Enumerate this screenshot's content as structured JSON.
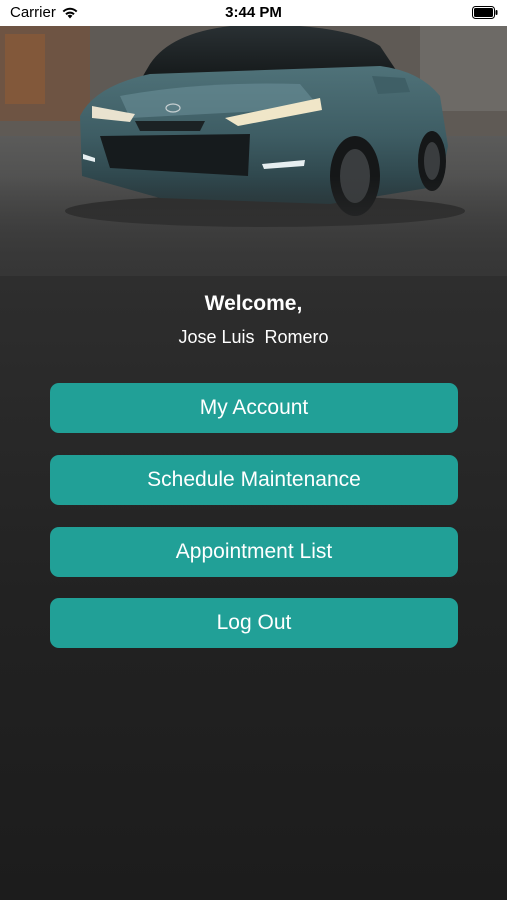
{
  "status_bar": {
    "carrier": "Carrier",
    "time": "3:44 PM",
    "icons": [
      "wifi-icon",
      "battery-icon"
    ]
  },
  "hero": {
    "image": "car-hero-photo"
  },
  "greeting": {
    "title": "Welcome,",
    "user_name": "Jose Luis  Romero"
  },
  "menu": {
    "my_account": "My Account",
    "schedule_maintenance": "Schedule Maintenance",
    "appointment_list": "Appointment List",
    "log_out": "Log Out"
  },
  "colors": {
    "accent": "#21a097",
    "background": "#2a2a2a",
    "text": "#ffffff"
  }
}
